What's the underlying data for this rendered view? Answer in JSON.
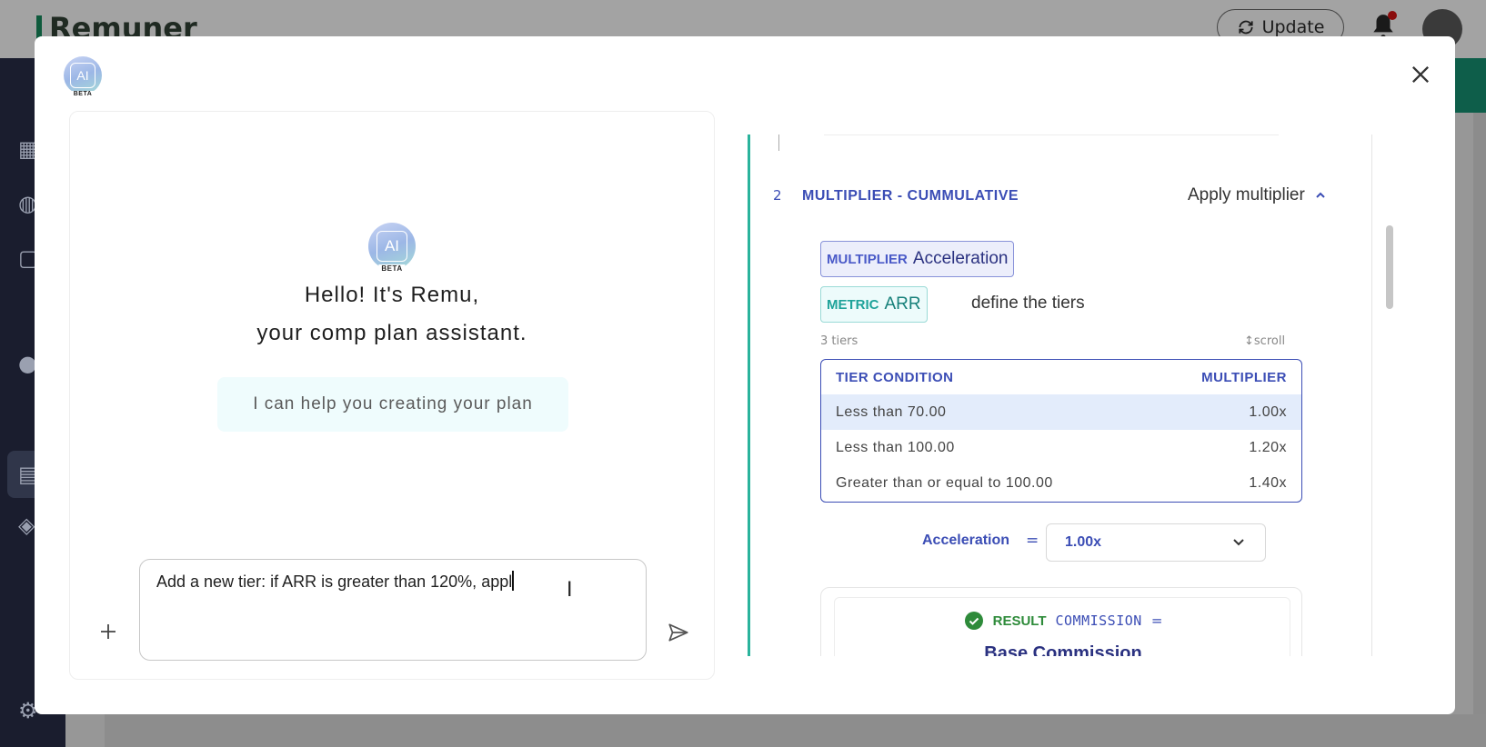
{
  "background": {
    "brand": "Remuner",
    "update_label": "Update"
  },
  "modal": {
    "logo": {
      "ai": "AI",
      "beta": "BETA"
    }
  },
  "chat": {
    "greeting_line1": "Hello! It's Remu,",
    "greeting_line2": "your comp plan assistant.",
    "help_text": "I can help you creating your plan",
    "input_value": "Add a new tier: if ARR is greater than 120%, appl"
  },
  "plan": {
    "step_number": "2",
    "step_title": "MULTIPLIER - CUMMULATIVE",
    "apply_label": "Apply multiplier",
    "multiplier_tag": {
      "key": "MULTIPLIER",
      "value": "Acceleration"
    },
    "metric_tag": {
      "key": "METRIC",
      "value": "ARR"
    },
    "define_tiers": "define the tiers",
    "tiers_count": "3 tiers",
    "scroll_hint": "↕scroll",
    "table": {
      "headers": [
        "TIER CONDITION",
        "MULTIPLIER"
      ],
      "rows": [
        {
          "condition": "Less than 70.00",
          "multiplier": "1.00x"
        },
        {
          "condition": "Less than 100.00",
          "multiplier": "1.20x"
        },
        {
          "condition": "Greater than or equal to 100.00",
          "multiplier": "1.40x"
        }
      ]
    },
    "acceleration_label": "Acceleration",
    "equals": "=",
    "acceleration_value": "1.00x",
    "result": {
      "key": "RESULT",
      "value": "COMMISSION",
      "equals": "=",
      "sub": "Base Commission"
    }
  },
  "colors": {
    "accent": "#3b4db5",
    "teal": "#2ab39c",
    "success": "#2e8b3a"
  }
}
